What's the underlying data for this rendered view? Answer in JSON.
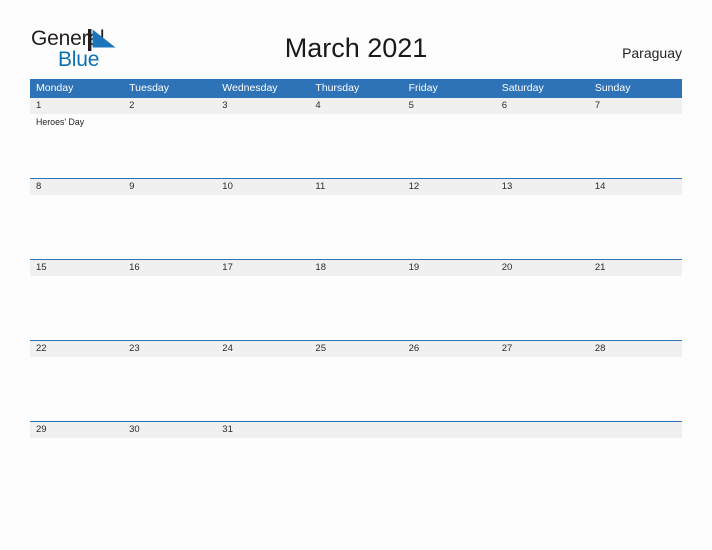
{
  "logo": {
    "word_one": "General",
    "word_two": "Blue",
    "flag_icon": "blue-flag-triangle-icon",
    "dark_color": "#231f20",
    "blue_color": "#0b72b5"
  },
  "header": {
    "title": "March 2021",
    "locale": "Paraguay"
  },
  "colors": {
    "header_blue": "#2e72b8",
    "date_band_gray": "#f0f0f0",
    "page_background": "#fdfdfd",
    "text_dark": "#231f20"
  },
  "calendar": {
    "weekdays": [
      "Monday",
      "Tuesday",
      "Wednesday",
      "Thursday",
      "Friday",
      "Saturday",
      "Sunday"
    ],
    "weeks": [
      {
        "days": [
          {
            "date": "1",
            "event": "Heroes' Day"
          },
          {
            "date": "2",
            "event": ""
          },
          {
            "date": "3",
            "event": ""
          },
          {
            "date": "4",
            "event": ""
          },
          {
            "date": "5",
            "event": ""
          },
          {
            "date": "6",
            "event": ""
          },
          {
            "date": "7",
            "event": ""
          }
        ]
      },
      {
        "days": [
          {
            "date": "8",
            "event": ""
          },
          {
            "date": "9",
            "event": ""
          },
          {
            "date": "10",
            "event": ""
          },
          {
            "date": "11",
            "event": ""
          },
          {
            "date": "12",
            "event": ""
          },
          {
            "date": "13",
            "event": ""
          },
          {
            "date": "14",
            "event": ""
          }
        ]
      },
      {
        "days": [
          {
            "date": "15",
            "event": ""
          },
          {
            "date": "16",
            "event": ""
          },
          {
            "date": "17",
            "event": ""
          },
          {
            "date": "18",
            "event": ""
          },
          {
            "date": "19",
            "event": ""
          },
          {
            "date": "20",
            "event": ""
          },
          {
            "date": "21",
            "event": ""
          }
        ]
      },
      {
        "days": [
          {
            "date": "22",
            "event": ""
          },
          {
            "date": "23",
            "event": ""
          },
          {
            "date": "24",
            "event": ""
          },
          {
            "date": "25",
            "event": ""
          },
          {
            "date": "26",
            "event": ""
          },
          {
            "date": "27",
            "event": ""
          },
          {
            "date": "28",
            "event": ""
          }
        ]
      },
      {
        "days": [
          {
            "date": "29",
            "event": ""
          },
          {
            "date": "30",
            "event": ""
          },
          {
            "date": "31",
            "event": ""
          },
          {
            "date": "",
            "event": ""
          },
          {
            "date": "",
            "event": ""
          },
          {
            "date": "",
            "event": ""
          },
          {
            "date": "",
            "event": ""
          }
        ]
      }
    ]
  }
}
